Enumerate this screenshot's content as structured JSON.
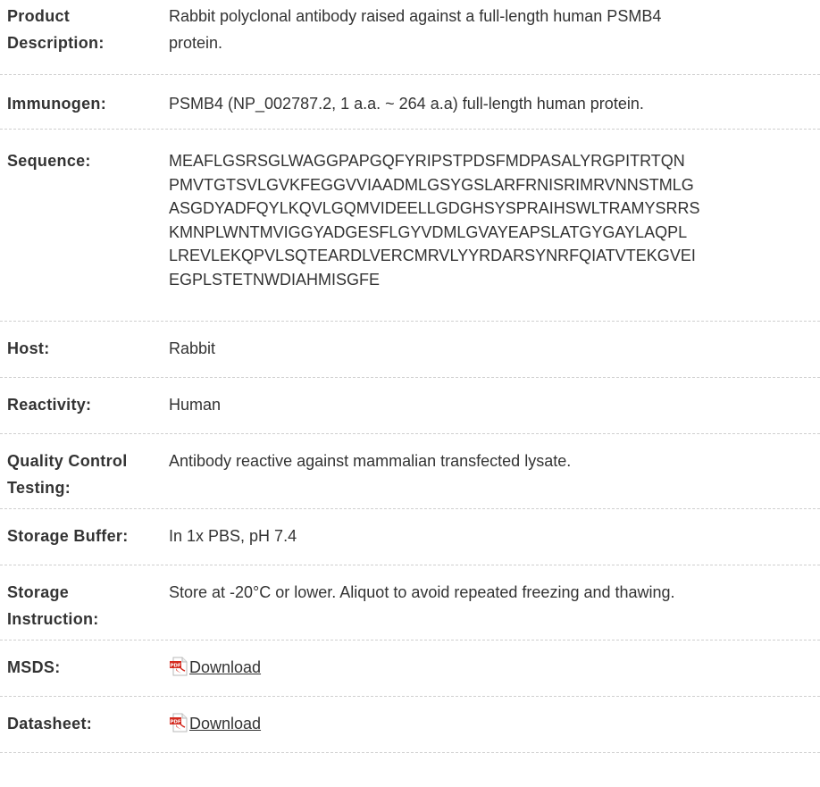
{
  "rows": {
    "description": {
      "label_line1": "Product",
      "label_line2": "Description:",
      "value_line1": "Rabbit polyclonal antibody raised against a full-length human PSMB4",
      "value_line2": "protein."
    },
    "immunogen": {
      "label": "Immunogen:",
      "value": "PSMB4 (NP_002787.2, 1 a.a. ~ 264 a.a) full-length human protein."
    },
    "sequence": {
      "label": "Sequence:",
      "lines": [
        "MEAFLGSRSGLWAGGPAPGQFYRIPSTPDSFMDPASALYRGPITRTQN",
        "PMVTGTSVLGVKFEGGVVIAADMLGSYGSLARFRNISRIMRVNNSTMLG",
        "ASGDYADFQYLKQVLGQMVIDEELLGDGHSYSPRAIHSWLTRAMYSRRS",
        "KMNPLWNTMVIGGYADGESFLGYVDMLGVAYEAPSLATGYGAYLAQPL",
        "LREVLEKQPVLSQTEARDLVERCMRVLYYRDARSYNRFQIATVTEKGVEI",
        "EGPLSTETNWDIAHMISGFE"
      ]
    },
    "host": {
      "label": "Host:",
      "value": "Rabbit"
    },
    "reactivity": {
      "label": "Reactivity:",
      "value": "Human"
    },
    "quality_control": {
      "label_line1": "Quality Control",
      "label_line2": "Testing:",
      "value": "Antibody reactive against mammalian transfected lysate."
    },
    "storage_buffer": {
      "label": "Storage Buffer:",
      "value": "In 1x PBS, pH 7.4"
    },
    "storage_instruction": {
      "label_line1": "Storage",
      "label_line2": "Instruction:",
      "value": "Store at -20°C or lower. Aliquot to avoid repeated freezing and thawing."
    },
    "msds": {
      "label": "MSDS:",
      "link_text": "Download",
      "icon": "pdf-icon"
    },
    "datasheet": {
      "label": "Datasheet:",
      "link_text": "Download",
      "icon": "pdf-icon"
    }
  },
  "colors": {
    "text": "#333333",
    "divider": "#cfcfcf",
    "pdf_icon_red": "#d42a1f"
  }
}
